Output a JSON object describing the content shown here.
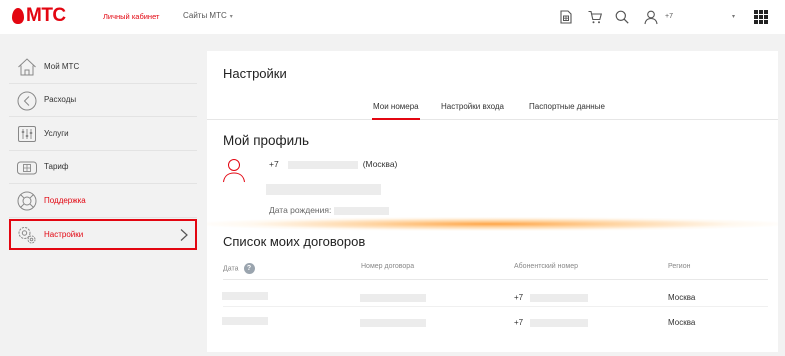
{
  "header": {
    "logo_text": "МТС",
    "cabinet_label": "Личный кабинет",
    "sites_label": "Сайты МТС",
    "phone_prefix": "+7",
    "icons": [
      "sim-card-icon",
      "cart-icon",
      "search-icon",
      "user-icon",
      "apps-grid-icon"
    ]
  },
  "sidebar": {
    "items": [
      {
        "label": "Мой МТС",
        "icon": "home-icon"
      },
      {
        "label": "Расходы",
        "icon": "expenses-icon"
      },
      {
        "label": "Услуги",
        "icon": "services-icon"
      },
      {
        "label": "Тариф",
        "icon": "tariff-icon"
      },
      {
        "label": "Поддержка",
        "icon": "support-icon"
      },
      {
        "label": "Настройки",
        "icon": "settings-icon",
        "active": true
      }
    ]
  },
  "main": {
    "title": "Настройки",
    "tabs": [
      {
        "label": "Мои номера",
        "active": true
      },
      {
        "label": "Настройки входа"
      },
      {
        "label": "Паспортные данные"
      }
    ],
    "profile": {
      "title": "Мой профиль",
      "phone_prefix": "+7",
      "city": "(Москва)",
      "birth_label": "Дата рождения:"
    },
    "contracts": {
      "title": "Список моих договоров",
      "columns": [
        "Дата",
        "Номер договора",
        "Абонентский номер",
        "Регион"
      ],
      "info_icon": "?",
      "rows": [
        {
          "phone_prefix": "+7",
          "region": "Москва"
        },
        {
          "phone_prefix": "+7",
          "region": "Москва"
        }
      ]
    }
  },
  "colors": {
    "brand_red": "#e30611",
    "background": "#f2f2f2",
    "card": "#ffffff"
  }
}
